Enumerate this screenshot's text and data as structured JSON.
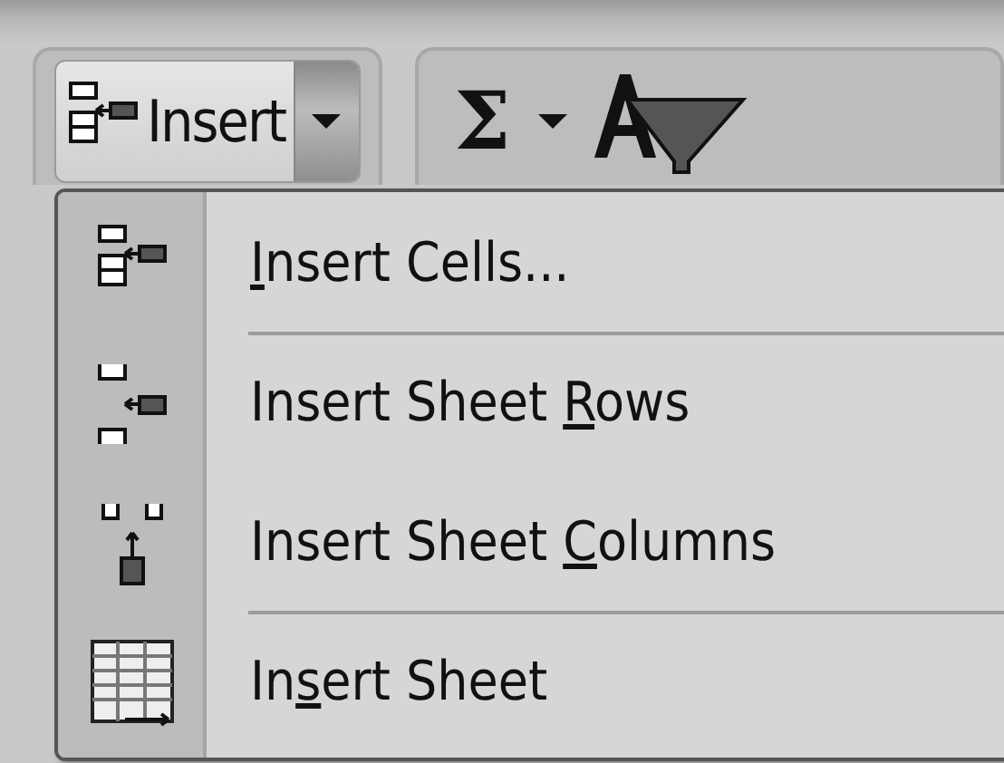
{
  "ribbon": {
    "insert_button": {
      "label": "Insert"
    },
    "sum_button": {
      "label": "Σ"
    }
  },
  "menu": {
    "items": [
      {
        "kind": "cells",
        "key": "I",
        "rest": "nsert Cells...",
        "separator_before": false
      },
      {
        "kind": "rows",
        "prefix": "Insert Sheet ",
        "key": "R",
        "rest": "ows",
        "separator_before": true
      },
      {
        "kind": "columns",
        "prefix": "Insert Sheet ",
        "key": "C",
        "rest": "olumns",
        "separator_before": false
      },
      {
        "kind": "sheet",
        "prefix": "In",
        "key": "s",
        "rest": "ert Sheet",
        "separator_before": true
      }
    ]
  }
}
